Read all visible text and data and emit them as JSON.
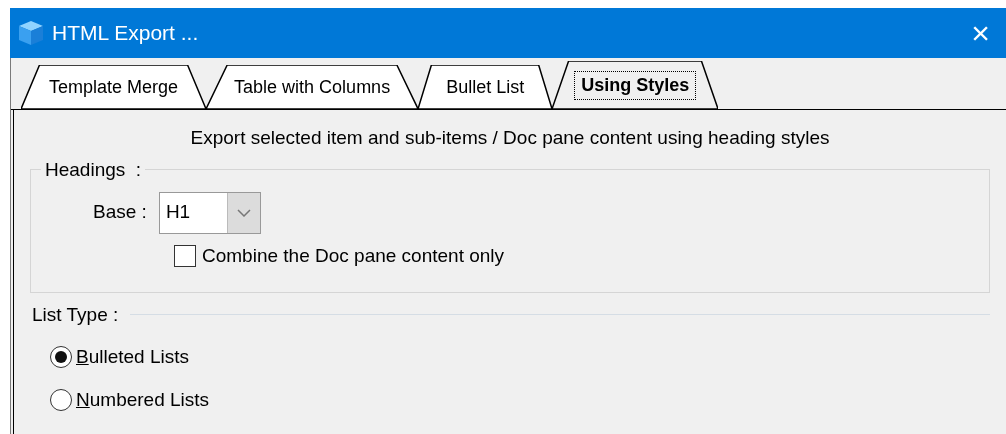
{
  "window": {
    "title": "HTML Export ...",
    "close": "×"
  },
  "tabs": [
    {
      "label": "Template Merge",
      "selected": false
    },
    {
      "label": "Table with Columns",
      "selected": false
    },
    {
      "label": "Bullet List",
      "selected": false
    },
    {
      "label": "Using Styles",
      "selected": true
    }
  ],
  "description": "Export selected item and sub-items / Doc pane content using heading styles",
  "headings": {
    "legend": "Headings  :",
    "base_label": "Base :",
    "base_value": "H1",
    "combine": {
      "label": "Combine the Doc pane content only",
      "checked": false
    }
  },
  "list_type": {
    "legend": "List Type :",
    "options": [
      {
        "label": "Bulleted Lists",
        "selected": true,
        "underline_first": true
      },
      {
        "label": "Numbered Lists",
        "selected": false,
        "underline_first": true
      }
    ]
  }
}
